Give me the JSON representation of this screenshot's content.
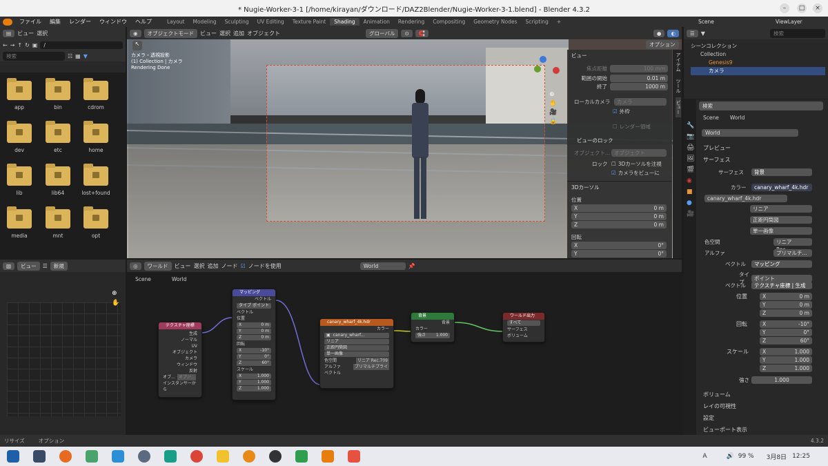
{
  "window": {
    "title": "* Nugie-Worker-3-1 [/home/kirayan/ダウンロード/DAZ2Blender/Nugie-Worker-3-1.blend] - Blender 4.3.2"
  },
  "menu": [
    "ファイル",
    "編集",
    "レンダー",
    "ウィンドウ",
    "ヘルプ"
  ],
  "workspaces": [
    "Layout",
    "Modeling",
    "Sculpting",
    "UV Editing",
    "Texture Paint",
    "Shading",
    "Animation",
    "Rendering",
    "Compositing",
    "Geometry Nodes",
    "Scripting",
    "+"
  ],
  "active_workspace": "Shading",
  "topright": {
    "scene": "Scene",
    "viewlayer": "ViewLayer"
  },
  "filebrowser": {
    "header": [
      "ビュー",
      "選択"
    ],
    "path": "/",
    "search_placeholder": "検索",
    "folders": [
      "app",
      "bin",
      "cdrom",
      "dev",
      "etc",
      "home",
      "lib",
      "lib64",
      "lost+found",
      "media",
      "mnt",
      "opt"
    ]
  },
  "viewport": {
    "mode": "オブジェクトモード",
    "menus": [
      "ビュー",
      "選択",
      "追加",
      "オブジェクト"
    ],
    "transform": "グローバル",
    "options": "オプション",
    "overlay_lines": [
      "カメラ・透視投影",
      "(1) Collection | カメラ",
      "Rendering Done"
    ]
  },
  "npanel": {
    "view_header": "ビュー",
    "focal_label": "焦点距離",
    "focal_value": "100 mm",
    "clip_start_label": "範囲の開始",
    "clip_start_value": "0.01 m",
    "clip_end_label": "終了",
    "clip_end_value": "1000 m",
    "local_camera_label": "ローカルカメラ",
    "local_camera_value": "カメラ",
    "outside_label": "外枠",
    "render_region_label": "レンダー領域",
    "lock_header": "ビューのロック",
    "object_label": "オブジェクト...",
    "object_value": "オブジェクト",
    "lock_label": "ロック",
    "lock_3dcursor": "3Dカーソルを注視",
    "lock_camera": "カメラをビューに",
    "cursor_header": "3Dカーソル",
    "location_label": "位置",
    "loc": [
      [
        "X",
        "0 m"
      ],
      [
        "Y",
        "0 m"
      ],
      [
        "Z",
        "0 m"
      ]
    ],
    "rotation_label": "回転",
    "rot": [
      [
        "X",
        "0°"
      ],
      [
        "Y",
        "0°"
      ]
    ],
    "side_tabs": [
      "アイテム",
      "ツール",
      "ビュー"
    ]
  },
  "outliner": {
    "search_placeholder": "検索",
    "items": [
      "シーンコレクション",
      "Collection",
      "Genesis9",
      "カメラ"
    ]
  },
  "properties": {
    "search_placeholder": "検索",
    "breadcrumb": [
      "Scene",
      "World"
    ],
    "world_name": "World",
    "sections": {
      "preview": "プレビュー",
      "surface": "サーフェス",
      "volume": "ボリューム",
      "visibility": "レイの可視性",
      "settings": "設定",
      "viewport": "ビューポート表示"
    },
    "surface_label": "サーフェス",
    "surface_value": "背景",
    "color_label": "カラー",
    "color_value": "canary_wharf_4k.hdr",
    "image_name": "canary_wharf_4k.hdr",
    "interp": "リニア",
    "projection": "正距円筒図",
    "extension": "単一画像",
    "colorspace_label": "色空間",
    "colorspace_value": "リニア Rec....",
    "alpha_label": "アルファ",
    "alpha_value": "プリマルチ...",
    "vector_label": "ベクトル",
    "vector_value": "マッピング",
    "type_label": "タイプ",
    "type_value": "ポイント",
    "vector2_value": "テクスチャ座標 | 生成",
    "location_label": "位置",
    "loc": [
      [
        "X",
        "0 m"
      ],
      [
        "Y",
        "0 m"
      ],
      [
        "Z",
        "0 m"
      ]
    ],
    "rotation_label": "回転",
    "rot": [
      [
        "X",
        "-10°"
      ],
      [
        "Y",
        "0°"
      ],
      [
        "Z",
        "60°"
      ]
    ],
    "scale_label": "スケール",
    "scale": [
      [
        "X",
        "1.000"
      ],
      [
        "Y",
        "1.000"
      ],
      [
        "Z",
        "1.000"
      ]
    ],
    "strength_label": "強さ",
    "strength_value": "1.000"
  },
  "image_editor": {
    "view": "ビュー",
    "new": "新規"
  },
  "node_editor": {
    "type": "ワールド",
    "menus": [
      "ビュー",
      "選択",
      "追加",
      "ノード"
    ],
    "use_nodes": "ノードを使用",
    "world": "World",
    "breadcrumb": [
      "Scene",
      "World"
    ],
    "texcoord": {
      "title": "テクスチャ座標",
      "outputs": [
        "生成",
        "ノーマル",
        "UV",
        "オブジェクト",
        "カメラ",
        "ウィンドウ",
        "反射"
      ],
      "obj": "オブ...",
      "obj_field": "オブジ...",
      "instancer": "インスタンサーから"
    },
    "mapping": {
      "title": "マッピング",
      "out": "ベクトル",
      "type_label": "タイプ",
      "type": "ポイント",
      "vec": "ベクトル",
      "loc": "位置",
      "locv": [
        [
          "X",
          "0 m"
        ],
        [
          "Y",
          "0 m"
        ],
        [
          "Z",
          "0 m"
        ]
      ],
      "rot": "回転",
      "rotv": [
        [
          "X",
          "-10°"
        ],
        [
          "Y",
          "0°"
        ],
        [
          "Z",
          "60°"
        ]
      ],
      "scale": "スケール",
      "scalev": [
        [
          "X",
          "1.000"
        ],
        [
          "Y",
          "1.000"
        ],
        [
          "Z",
          "1.000"
        ]
      ]
    },
    "envtex": {
      "title": "canary_wharf_4k.hdr",
      "out": "カラー",
      "img": "canary_wharf...",
      "opts": [
        "リニア",
        "正距円筒図",
        "単一画像"
      ],
      "cs_label": "色空間",
      "cs": "リニア Rec.709",
      "alpha_label": "アルファ",
      "alpha": "プリマルチプライ",
      "vec": "ベクトル"
    },
    "background": {
      "title": "背景",
      "out": "背景",
      "color": "カラー",
      "strength": "強さ",
      "strength_v": "1.000"
    },
    "output": {
      "title": "ワールド出力",
      "target": "すべて",
      "surface": "サーフェス",
      "volume": "ボリューム"
    }
  },
  "statusbar": {
    "left1": "リサイズ",
    "left2": "オプション",
    "version": "4.3.2"
  },
  "taskbar": {
    "lang": "A",
    "battery": "99 %",
    "date": "3月8日",
    "time": "12:25"
  }
}
